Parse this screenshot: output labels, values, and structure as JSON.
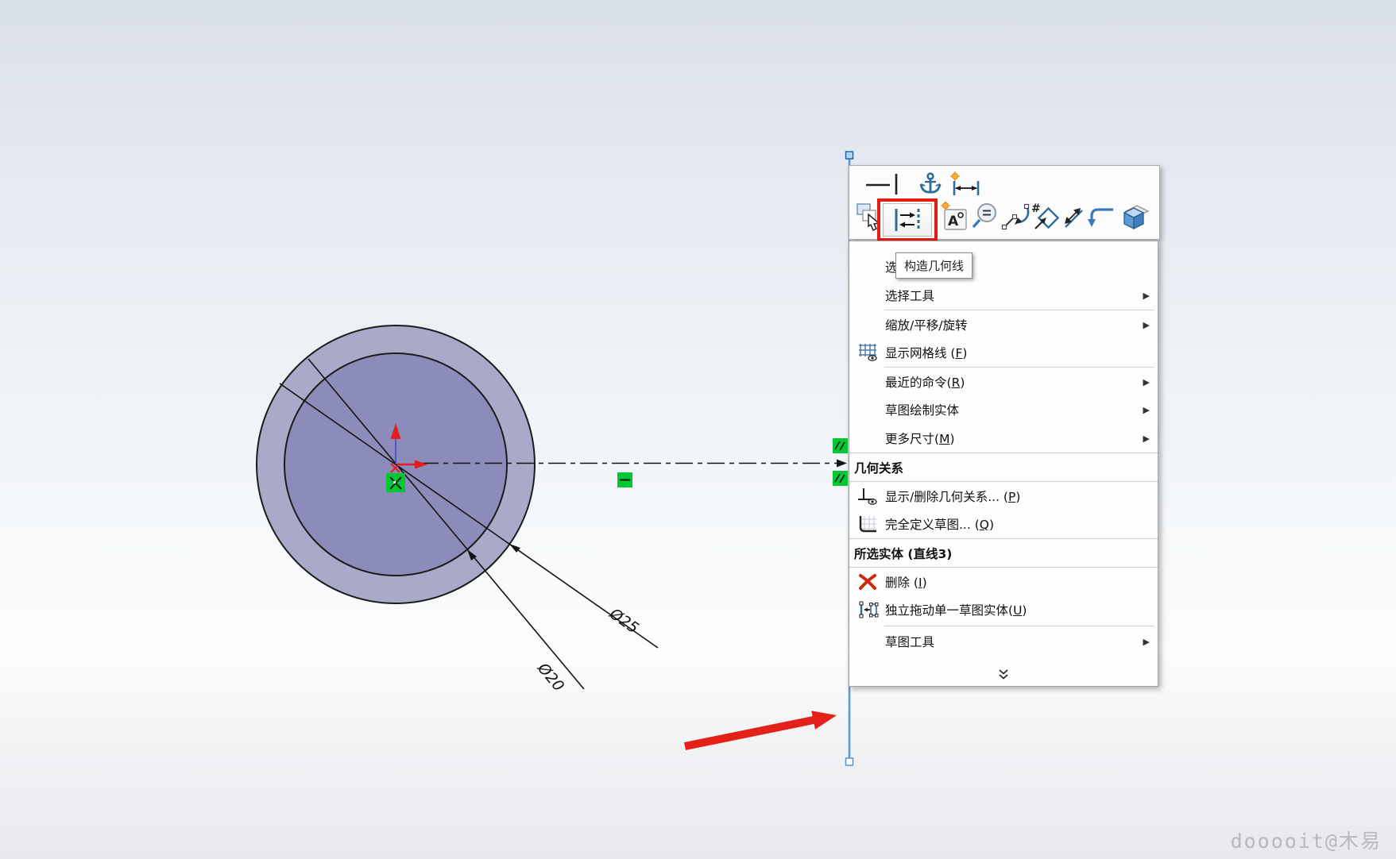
{
  "app": "SolidWorks sketch viewport",
  "viewport": {
    "dimensions": {
      "outer": "Ø25",
      "inner": "Ø20"
    },
    "selected_entity": "直线3",
    "colors": {
      "ring_fill": "#a9aac9",
      "inner_disk_fill": "#8b8cba",
      "selected_line": "#5b9bd5",
      "relation_badge": "#00c832",
      "annotation_arrow": "#e32119",
      "highlight_box": "#e41b13",
      "origin_arrow": "#e02020"
    }
  },
  "context_toolbar": {
    "row1_icons": [
      "make-horizontal",
      "make-vertical",
      "anchor-fix",
      "smart-dimension"
    ],
    "row2_icons": [
      "select-other",
      "construction-geometry",
      "add-note",
      "zoom-to-selection",
      "trim-entities",
      "sketch-pattern",
      "move-entities",
      "offset-entities",
      "extrude"
    ],
    "selected_tool": "construction-geometry"
  },
  "tooltip": {
    "text": "构造几何线"
  },
  "menu": {
    "items": [
      {
        "type": "item",
        "label": "选"
      },
      {
        "type": "item",
        "label": "选择工具",
        "submenu": true
      },
      {
        "type": "item",
        "label": "缩放/平移/旋转",
        "submenu": true
      },
      {
        "type": "item",
        "label": "显示网格线 (F)",
        "icon": "grid-eye"
      },
      {
        "type": "item",
        "label": "最近的命令(R)",
        "submenu": true
      },
      {
        "type": "item",
        "label": "草图绘制实体",
        "submenu": true
      },
      {
        "type": "item",
        "label": "更多尺寸(M)",
        "submenu": true
      },
      {
        "type": "header",
        "label": "几何关系"
      },
      {
        "type": "item",
        "label": "显示/删除几何关系... (P)",
        "icon": "perpendicular-eye"
      },
      {
        "type": "item",
        "label": "完全定义草图... (Q)",
        "icon": "fully-define"
      },
      {
        "type": "header",
        "label": "所选实体 (直线3)"
      },
      {
        "type": "item",
        "label": "删除 (I)",
        "icon": "delete-x"
      },
      {
        "type": "item",
        "label": "独立拖动单一草图实体(U)",
        "icon": "drag-single"
      },
      {
        "type": "item",
        "label": "草图工具",
        "submenu": true
      }
    ]
  },
  "watermark": "dooooit@木易"
}
